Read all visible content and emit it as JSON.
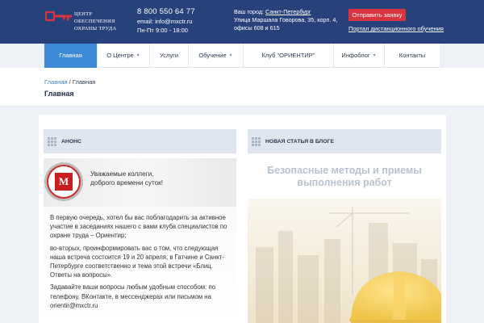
{
  "header": {
    "logo_text": "Центр обеспечения охраны труда",
    "phone": "8 800 550 64 77",
    "email": "email: info@mxctr.ru",
    "hours": "Пн-Пт 9:00 - 18:00",
    "city_label": "Ваш город:",
    "city_value": "Санкт-Петербург",
    "address": "Улица Маршала Говорова, 35, корп. 4, офисы 608 и 615",
    "request_button": "Отправить заявку",
    "portal_link": "Портал дистанционного обучения"
  },
  "nav": {
    "items": [
      {
        "label": "Главная",
        "active": true
      },
      {
        "label": "О Центре",
        "dropdown": true
      },
      {
        "label": "Услуги"
      },
      {
        "label": "Обучение",
        "dropdown": true
      },
      {
        "label": "Клуб \"ОРИЕНТИР\""
      },
      {
        "label": "Инфоблог",
        "dropdown": true
      },
      {
        "label": "Контакты"
      }
    ]
  },
  "breadcrumb": {
    "home": "Главная",
    "separator": " / ",
    "current": "Главная"
  },
  "page_title": "Главная",
  "anons": {
    "heading": "Анонс",
    "greeting": "Уважаемые коллеги,\nдоброго времени суток!",
    "badge_letter": "М",
    "paragraphs": [
      "В первую очередь, хотел бы вас поблагодарить за активное участие в заседаниях нашего с вами клуба специалистов по охране труда – Ориентир;",
      "во-вторых, проинформировать вас о том, что следующая наша встреча состоится 19 и 20 апреля, в Гатчине и Санкт-Петербурге соответственно и тема этой встречи «Блиц. Ответы на вопросы».",
      "Задавайте ваши вопросы любым удобным способом: по телефону, ВКонтакте, в мессенджерах или письмом на orientir@mxctr.ru"
    ]
  },
  "blog": {
    "heading": "Новая статья в блоге",
    "article_title": "Безопасные методы и приемы выполнения работ"
  },
  "colors": {
    "header_bg": "#27427a",
    "accent_blue": "#3d8ad6",
    "request_red": "#d9343d"
  }
}
